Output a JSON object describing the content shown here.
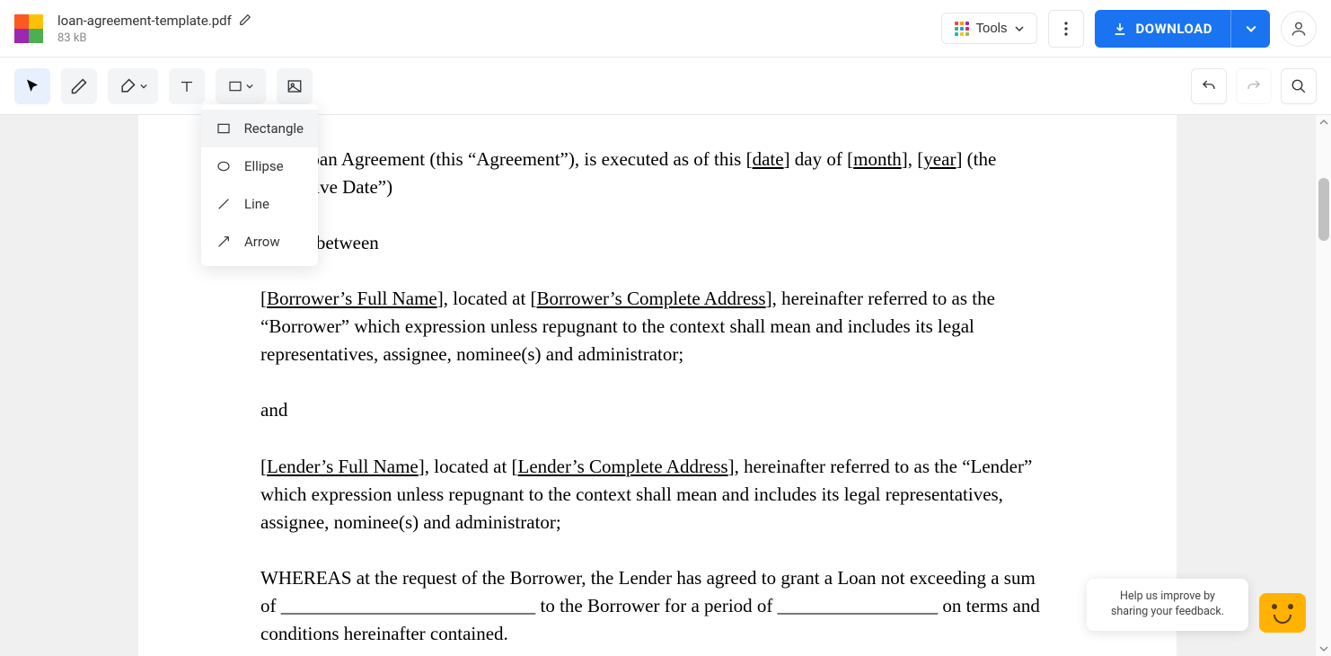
{
  "header": {
    "file_name": "loan-agreement-template.pdf",
    "file_size": "83 kB",
    "tools_label": "Tools",
    "download_label": "DOWNLOAD"
  },
  "shape_menu": {
    "rectangle": "Rectangle",
    "ellipse": "Ellipse",
    "line": "Line",
    "arrow": "Arrow"
  },
  "document": {
    "p1_prefix": "This Loan Agreement (this “Agreement”), is executed as of this [",
    "p1_date": "date",
    "p1_mid1": "] day of [",
    "p1_month": "month",
    "p1_mid2": "], [",
    "p1_year": "year",
    "p1_suffix": "] (the “Effective Date”)",
    "p2": "by and between",
    "p3_open": "[",
    "p3_borrower_name": "Borrower’s Full Name",
    "p3_mid1": "], located at [",
    "p3_borrower_addr": "Borrower’s Complete Address",
    "p3_rest": "], hereinafter referred to as the “Borrower” which expression unless repugnant to the context shall mean and includes its legal representatives, assignee, nominee(s) and administrator;",
    "p4": "and",
    "p5_open": "[",
    "p5_lender_name": "Lender’s Full Name",
    "p5_mid1": "], located at [",
    "p5_lender_addr": "Lender’s Complete Address",
    "p5_rest": "], hereinafter referred to as the “Lender” which expression unless repugnant to the context shall mean and includes its legal representatives, assignee, nominee(s) and administrator;",
    "p6": "WHEREAS at the request of the Borrower, the Lender has agreed to grant a Loan not exceeding a sum of ___________________________ to the Borrower for a period of _________________ on terms and conditions hereinafter contained."
  },
  "feedback": {
    "text": "Help us improve by sharing your feedback."
  },
  "colors": {
    "logo": [
      "#ff5722",
      "#ffc107",
      "#4caf50",
      "#9c27b0"
    ],
    "tools_dots": [
      "#f44336",
      "#ff9800",
      "#9c27b0",
      "#4caf50",
      "#2196f3",
      "#e91e63",
      "#00bcd4",
      "#ffc107",
      "#8bc34a"
    ]
  }
}
